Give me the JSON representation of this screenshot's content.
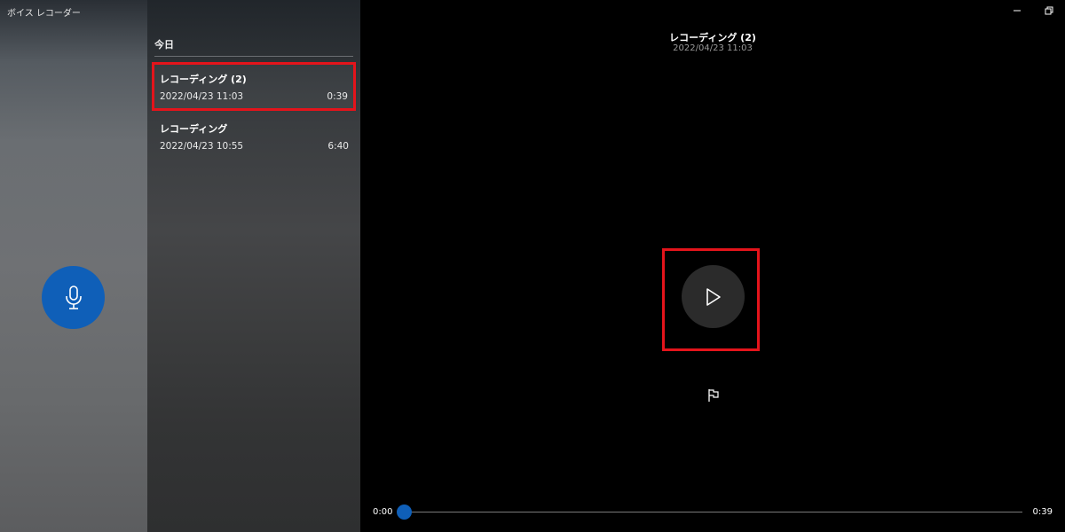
{
  "app": {
    "title": "ボイス レコーダー"
  },
  "list": {
    "group_header": "今日",
    "items": [
      {
        "name": "レコーディング (2)",
        "date": "2022/04/23 11:03",
        "duration": "0:39",
        "selected": true
      },
      {
        "name": "レコーディング",
        "date": "2022/04/23 10:55",
        "duration": "6:40",
        "selected": false
      }
    ]
  },
  "player": {
    "title": "レコーディング (2)",
    "date": "2022/04/23 11:03",
    "time_start": "0:00",
    "time_end": "0:39",
    "progress": 0
  },
  "icons": {
    "record": "microphone-icon",
    "play": "play-icon",
    "marker": "flag-icon",
    "minimize": "minimize-icon",
    "restore": "restore-icon"
  },
  "colors": {
    "accent": "#0f5fb8",
    "highlight": "#e4141b",
    "play_button": "#2b2b2b"
  }
}
